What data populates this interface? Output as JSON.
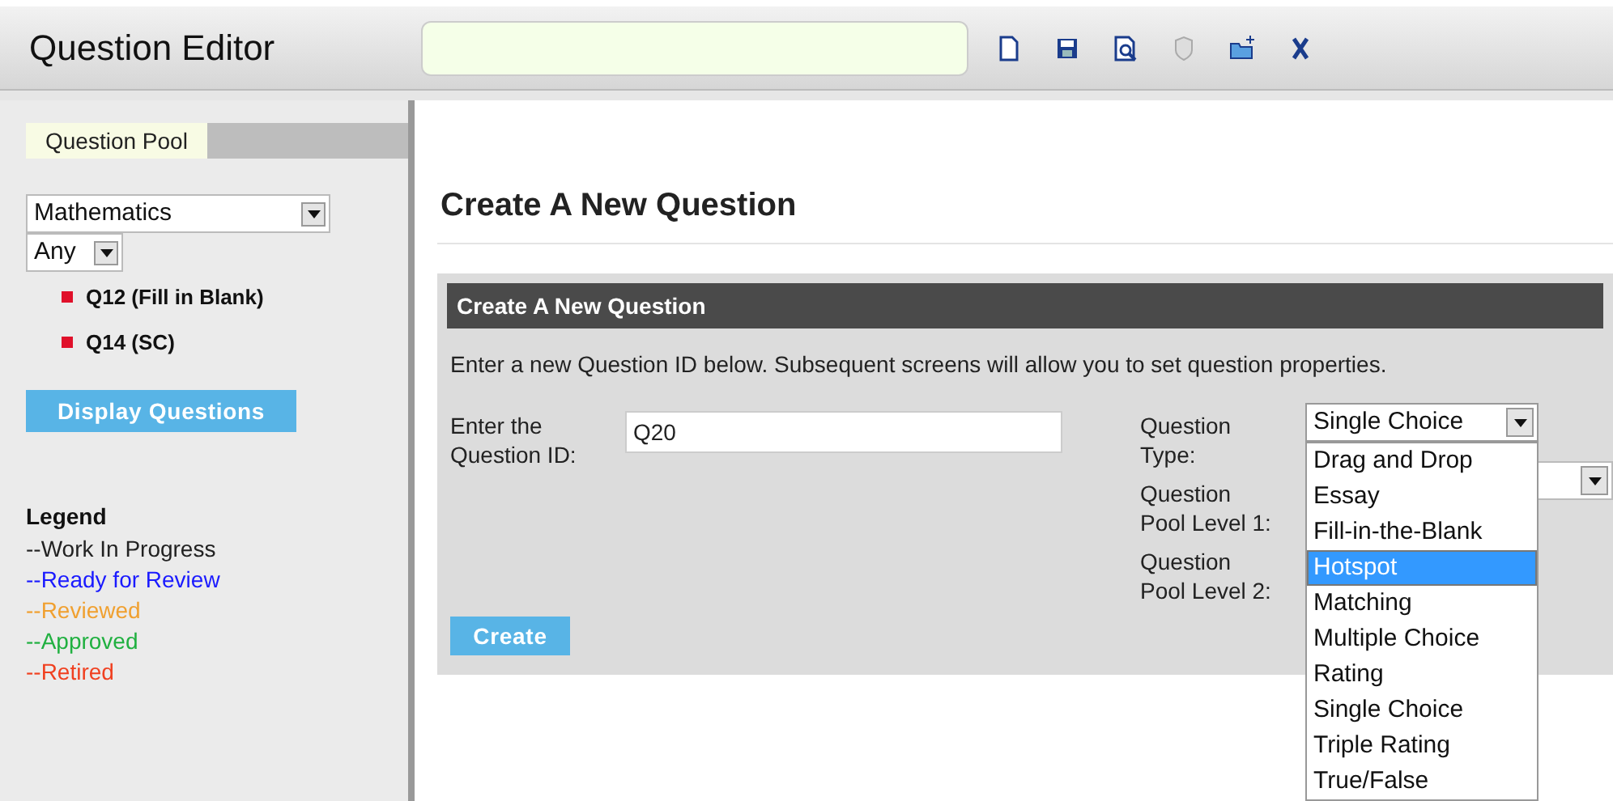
{
  "header": {
    "title": "Question Editor"
  },
  "sidebar": {
    "tab": {
      "label": "Question Pool",
      "selected": true
    },
    "subject_select": {
      "value": "Mathematics"
    },
    "status_select": {
      "value": "Any"
    },
    "questions": [
      {
        "label": "Q12 (Fill in Blank)",
        "color": "#e0102a"
      },
      {
        "label": "Q14 (SC)",
        "color": "#e0102a"
      }
    ],
    "display_button": "Display Questions",
    "legend": {
      "title": "Legend",
      "items": [
        {
          "label": "--Work In Progress",
          "color": "#222222"
        },
        {
          "label": "--Ready for Review",
          "color": "#1a1aff"
        },
        {
          "label": "--Reviewed",
          "color": "#f0a030"
        },
        {
          "label": "--Approved",
          "color": "#20b040"
        },
        {
          "label": "--Retired",
          "color": "#f04020"
        }
      ]
    }
  },
  "main": {
    "heading": "Create A New Question",
    "panel": {
      "title": "Create A New Question",
      "instructions": "Enter a new Question ID below. Subsequent screens will allow you to set question properties.",
      "id_label": "Enter the Question ID:",
      "id_value": "Q20",
      "type_label": "Question Type:",
      "type_value": "Single Choice",
      "pool1_label": "Question Pool Level 1:",
      "pool2_label": "Question Pool Level 2:",
      "type_options": [
        {
          "label": "Drag and Drop",
          "selected": false
        },
        {
          "label": "Essay",
          "selected": false
        },
        {
          "label": "Fill-in-the-Blank",
          "selected": false
        },
        {
          "label": "Hotspot",
          "selected": true
        },
        {
          "label": "Matching",
          "selected": false
        },
        {
          "label": "Multiple Choice",
          "selected": false
        },
        {
          "label": "Rating",
          "selected": false
        },
        {
          "label": "Single Choice",
          "selected": false
        },
        {
          "label": "Triple Rating",
          "selected": false
        },
        {
          "label": "True/False",
          "selected": false
        }
      ],
      "create_button": "Create"
    }
  }
}
